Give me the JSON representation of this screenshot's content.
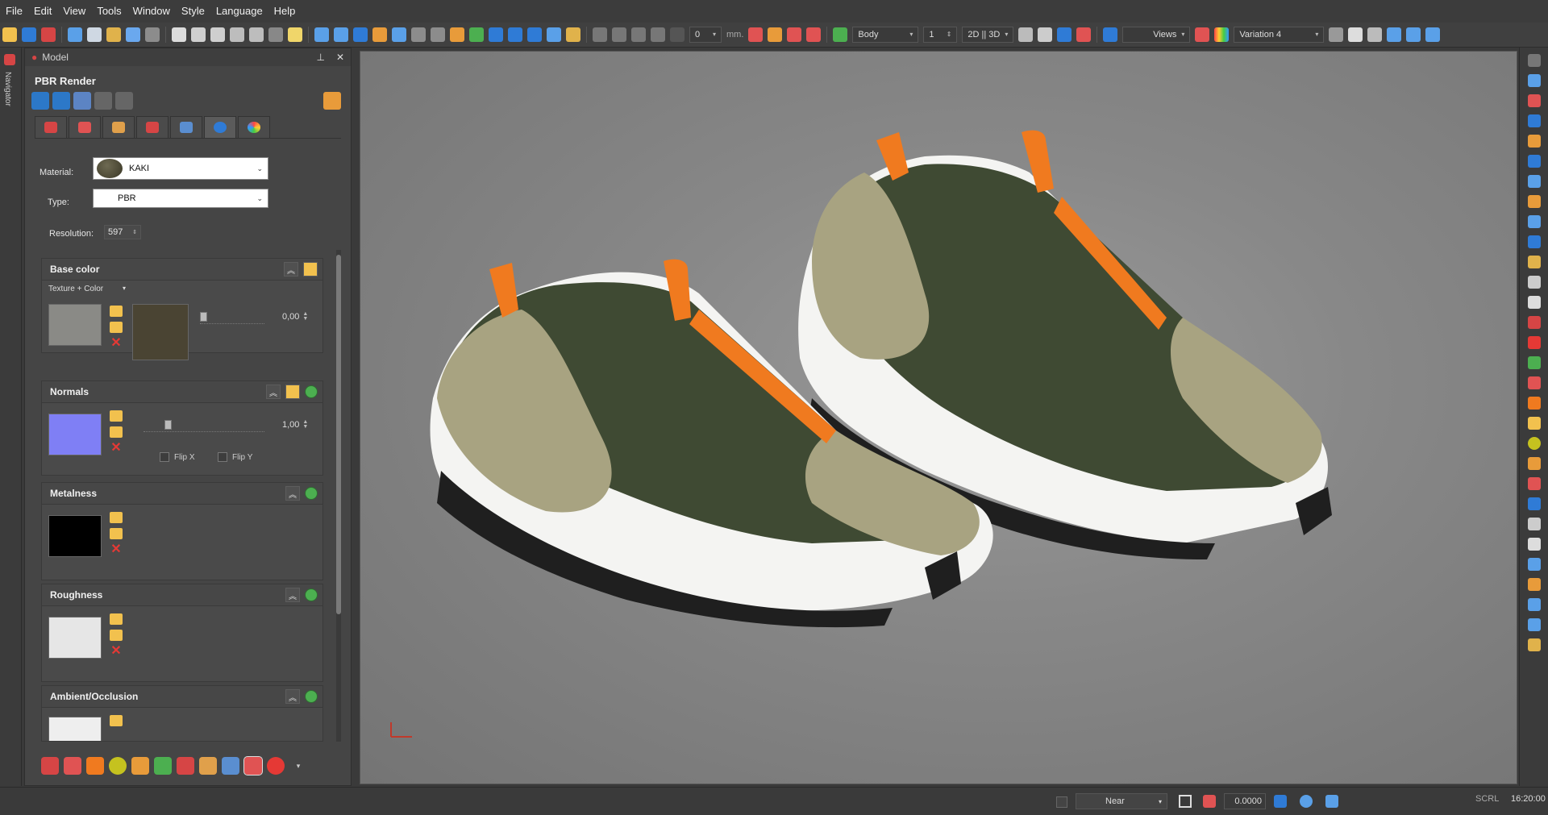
{
  "menubar": {
    "items": [
      "File",
      "Edit",
      "View",
      "Tools",
      "Window",
      "Style",
      "Language",
      "Help"
    ]
  },
  "toolbar": {
    "thickness_value": "0",
    "unit": "mm.",
    "body_select": "Body",
    "body_count": "1",
    "view_mode": "2D || 3D",
    "views_select": "Views",
    "variation_select": "Variation 4"
  },
  "leftstrip": {
    "navigator_label": "Navigator"
  },
  "panel": {
    "header_title": "Model",
    "pin_icon": "pin-icon",
    "close_icon": "close-icon",
    "title": "PBR Render",
    "material_label": "Material:",
    "material_value": "KAKI",
    "type_label": "Type:",
    "type_value": "PBR",
    "resolution_label": "Resolution:",
    "resolution_value": "597",
    "sections": {
      "base_color": {
        "title": "Base color",
        "mode": "Texture + Color",
        "value": "0,00",
        "swatch_color": "#8a8a86",
        "color_color": "#4a4433"
      },
      "normals": {
        "title": "Normals",
        "value": "1,00",
        "flip_x": "Flip X",
        "flip_y": "Flip Y",
        "swatch_color": "#7f7ff5"
      },
      "metalness": {
        "title": "Metalness",
        "swatch_color": "#000000"
      },
      "roughness": {
        "title": "Roughness",
        "swatch_color": "#e6e6e6"
      },
      "ambient_occlusion": {
        "title": "Ambient/Occlusion",
        "swatch_color": "#eeeeee"
      }
    }
  },
  "statusbar": {
    "snap_mode": "Near",
    "coordinate": "0.0000",
    "scroll_lock": "SCRL",
    "time": "16:20:00"
  },
  "colors": {
    "accent_orange": "#f07a1f",
    "shoe_green": "#3f4a33",
    "shoe_tan": "#a8a381",
    "sole_white": "#f4f4f2"
  }
}
